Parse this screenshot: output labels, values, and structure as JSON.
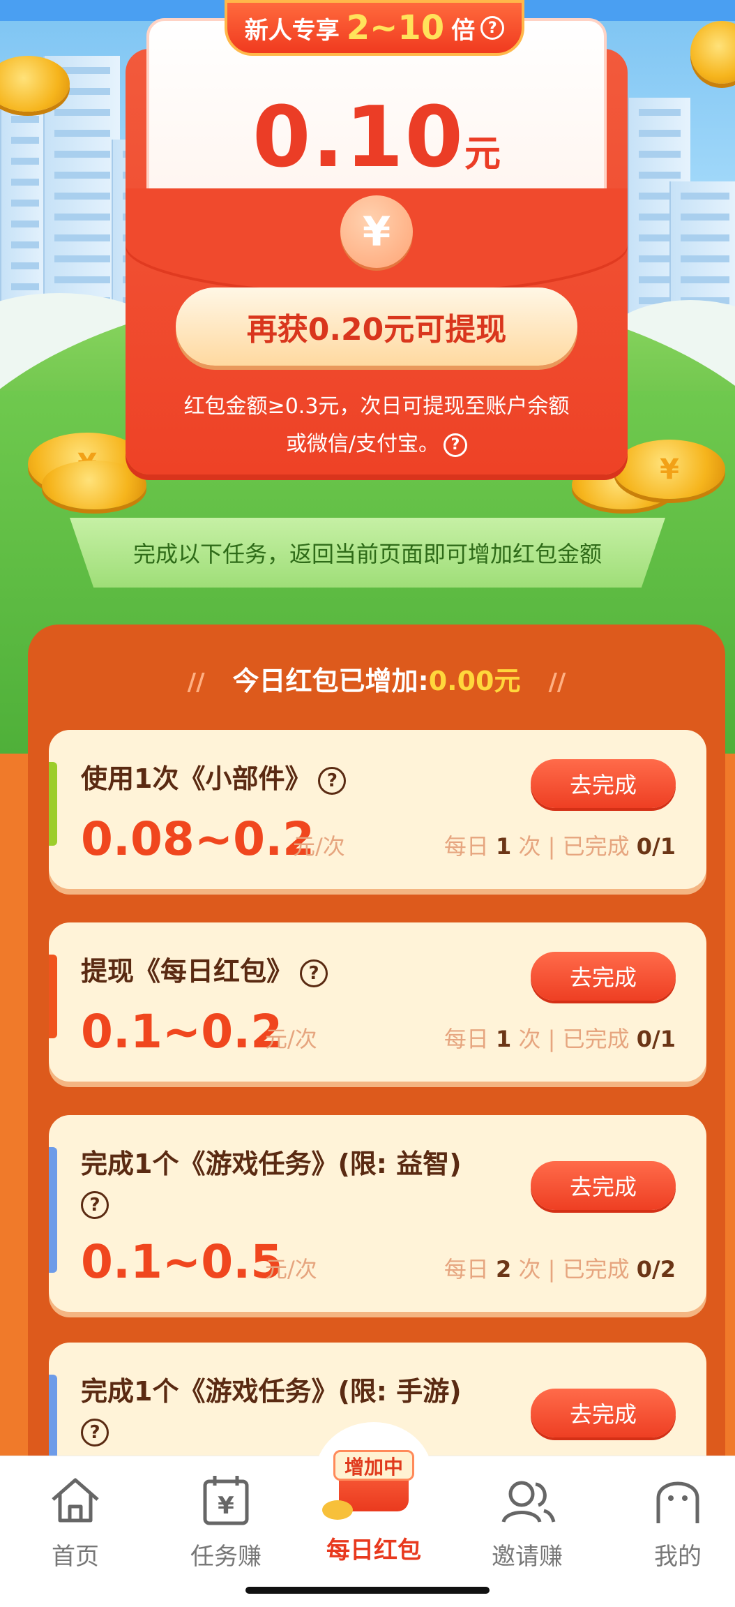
{
  "banner": {
    "badge_prefix": "新人专享",
    "badge_range": "2~10",
    "badge_suffix": "倍",
    "amount": "0.10",
    "amount_unit": "元",
    "yuan_symbol": "¥",
    "cashout_button": "再获0.20元可提现",
    "rule_line1": "红包金额≥0.3元，次日可提现至账户余额",
    "rule_line2": "或微信/支付宝。"
  },
  "ribbon_text": "完成以下任务，返回当前页面即可增加红包金额",
  "today": {
    "label": "今日红包已增加:",
    "value": "0.00元",
    "deco": "//"
  },
  "tasks": [
    {
      "title": "使用1次《小部件》",
      "button": "去完成",
      "reward": "0.08~0.2",
      "per": "元/次",
      "daily_label": "每日",
      "daily_count": "1",
      "daily_unit": "次",
      "done_label": "已完成",
      "done": "0/1",
      "accent": "#9ccd2b"
    },
    {
      "title": "提现《每日红包》",
      "button": "去完成",
      "reward": "0.1~0.2",
      "per": "元/次",
      "daily_label": "每日",
      "daily_count": "1",
      "daily_unit": "次",
      "done_label": "已完成",
      "done": "0/1",
      "accent": "#f0541e"
    },
    {
      "title": "完成1个《游戏任务》(限: 益智)",
      "button": "去完成",
      "reward": "0.1~0.5",
      "per": "元/次",
      "daily_label": "每日",
      "daily_count": "2",
      "daily_unit": "次",
      "done_label": "已完成",
      "done": "0/2",
      "accent": "#6d9be8"
    },
    {
      "title": "完成1个《游戏任务》(限: 手游)",
      "button": "去完成",
      "accent": "#6d9be8"
    }
  ],
  "nav": {
    "home": "首页",
    "tasks": "任务赚",
    "daily": "每日红包",
    "daily_tag": "增加中",
    "invite": "邀请赚",
    "mine": "我的"
  },
  "icons": {
    "help": "?",
    "home": "⌂",
    "tasks": "¥",
    "invite": "people",
    "mine": "ghost"
  }
}
